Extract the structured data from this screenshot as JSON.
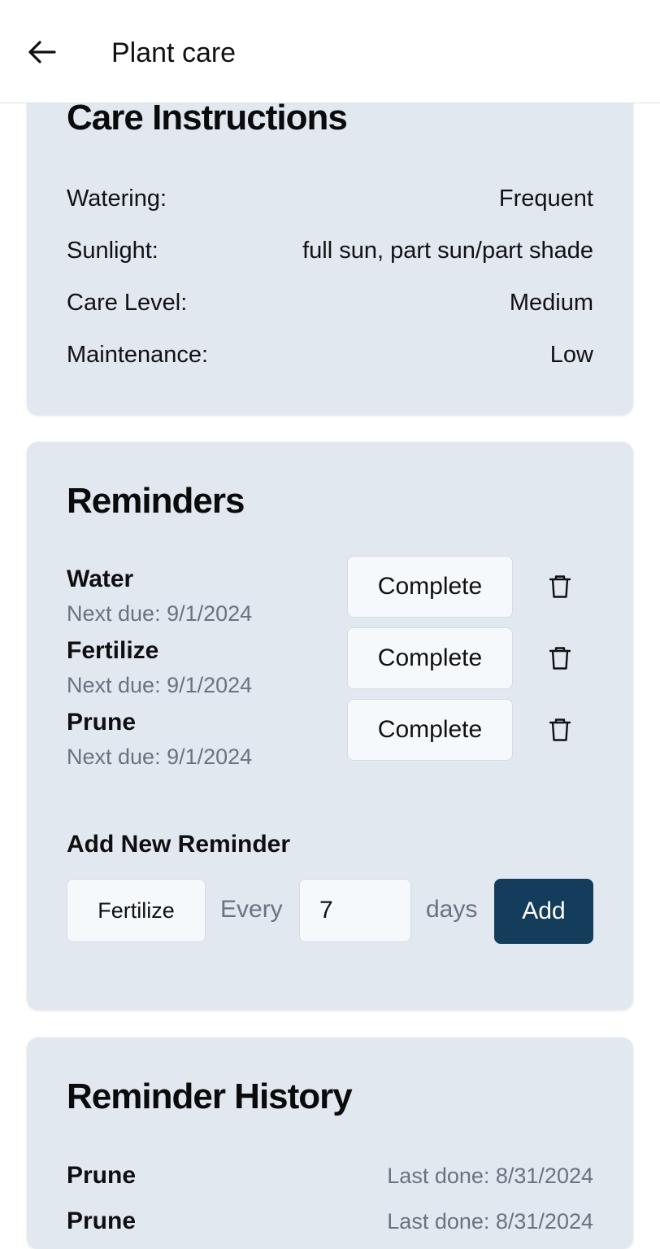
{
  "header": {
    "title": "Plant care",
    "back_icon": "arrow-left-icon"
  },
  "care": {
    "title": "Care Instructions",
    "rows": [
      {
        "label": "Watering:",
        "value": "Frequent"
      },
      {
        "label": "Sunlight:",
        "value": "full sun, part sun/part shade"
      },
      {
        "label": "Care Level:",
        "value": "Medium"
      },
      {
        "label": "Maintenance:",
        "value": "Low"
      }
    ]
  },
  "reminders": {
    "title": "Reminders",
    "items": [
      {
        "name": "Water",
        "due": "Next due: 9/1/2024",
        "action": "Complete",
        "delete_icon": "trash-icon"
      },
      {
        "name": "Fertilize",
        "due": "Next due: 9/1/2024",
        "action": "Complete",
        "delete_icon": "trash-icon"
      },
      {
        "name": "Prune",
        "due": "Next due: 9/1/2024",
        "action": "Complete",
        "delete_icon": "trash-icon"
      }
    ],
    "add": {
      "label": "Add New Reminder",
      "type_value": "Fertilize",
      "every_label": "Every",
      "interval_value": "7",
      "days_label": "days",
      "button_label": "Add"
    }
  },
  "history": {
    "title": "Reminder History",
    "items": [
      {
        "name": "Prune",
        "date": "Last done: 8/31/2024"
      },
      {
        "name": "Prune",
        "date": "Last done: 8/31/2024"
      }
    ]
  },
  "colors": {
    "card_bg": "#e2e8f0",
    "primary_button": "#143d5c",
    "muted_text": "#6b7280"
  }
}
